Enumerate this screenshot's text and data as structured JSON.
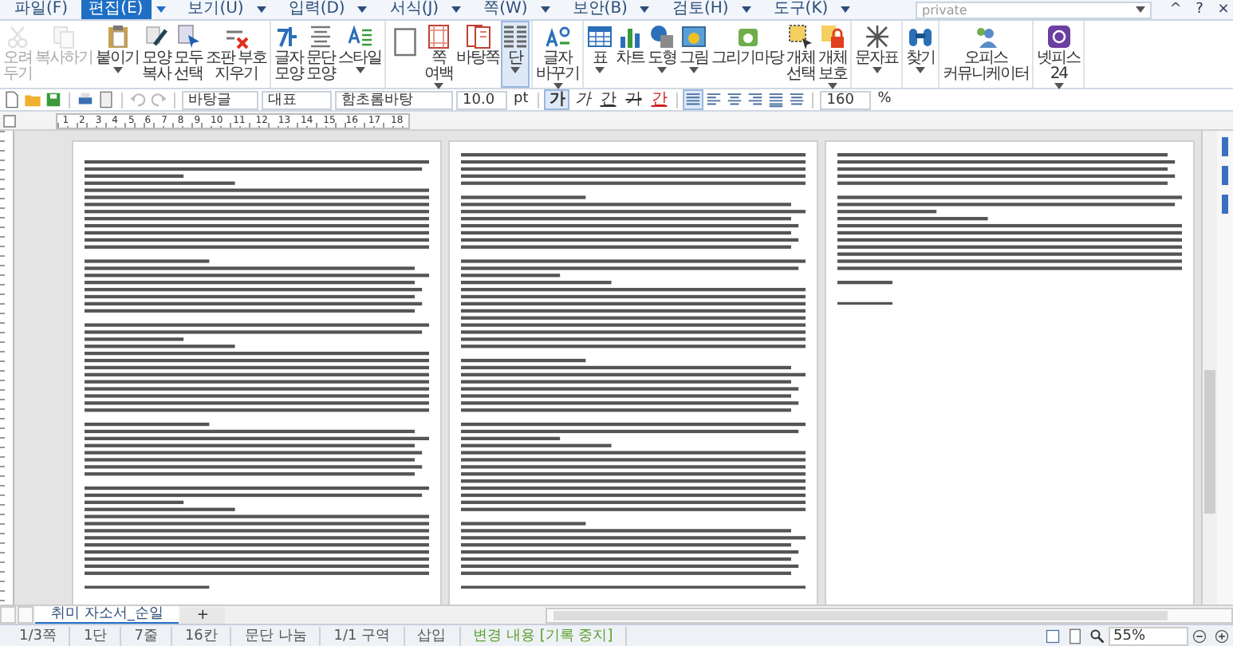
{
  "menu": [
    {
      "label": "파일(F)",
      "selected": false
    },
    {
      "label": "편집(E)",
      "selected": true
    },
    {
      "label": "보기(U)",
      "selected": false
    },
    {
      "label": "입력(D)",
      "selected": false
    },
    {
      "label": "서식(J)",
      "selected": false
    },
    {
      "label": "쪽(W)",
      "selected": false
    },
    {
      "label": "보안(B)",
      "selected": false
    },
    {
      "label": "검토(H)",
      "selected": false
    },
    {
      "label": "도구(K)",
      "selected": false
    }
  ],
  "search": {
    "value": "private"
  },
  "window_buttons": [
    "^",
    "?",
    "×"
  ],
  "ribbon": [
    {
      "buttons": [
        {
          "lines": [
            "오려",
            "두기"
          ],
          "disabled": true,
          "selected": false,
          "dropdown": false
        },
        {
          "lines": [
            "복사하기"
          ],
          "disabled": true,
          "selected": false,
          "dropdown": false
        },
        {
          "lines": [
            "붙이기"
          ],
          "disabled": false,
          "selected": false,
          "dropdown": true
        },
        {
          "lines": [
            "모양",
            "복사"
          ],
          "disabled": false,
          "selected": false,
          "dropdown": false
        },
        {
          "lines": [
            "모두",
            "선택"
          ],
          "disabled": false,
          "selected": false,
          "dropdown": false
        },
        {
          "lines": [
            "조판 부호",
            "지우기"
          ],
          "disabled": false,
          "selected": false,
          "dropdown": false
        }
      ]
    },
    {
      "buttons": [
        {
          "lines": [
            "글자",
            "모양"
          ],
          "disabled": false,
          "selected": false,
          "dropdown": false
        },
        {
          "lines": [
            "문단",
            "모양"
          ],
          "disabled": false,
          "selected": false,
          "dropdown": false
        },
        {
          "lines": [
            "스타일"
          ],
          "disabled": false,
          "selected": false,
          "dropdown": true
        }
      ]
    },
    {
      "buttons": [
        {
          "disabled": false,
          "selected": false,
          "dropdown": false
        },
        {
          "lines": [
            "쪽",
            "여백"
          ],
          "disabled": false,
          "selected": false,
          "dropdown": true
        },
        {
          "lines": [
            "바탕쪽"
          ],
          "disabled": false,
          "selected": false,
          "dropdown": false
        },
        {
          "lines": [
            "단"
          ],
          "disabled": false,
          "selected": true,
          "dropdown": true
        }
      ]
    },
    {
      "buttons": [
        {
          "lines": [
            "글자",
            "바꾸기"
          ],
          "disabled": false,
          "selected": false,
          "dropdown": true
        }
      ]
    },
    {
      "buttons": [
        {
          "lines": [
            "표"
          ],
          "disabled": false,
          "selected": false,
          "dropdown": true
        },
        {
          "lines": [
            "차트"
          ],
          "disabled": false,
          "selected": false,
          "dropdown": false
        },
        {
          "lines": [
            "도형"
          ],
          "disabled": false,
          "selected": false,
          "dropdown": true
        },
        {
          "lines": [
            "그림"
          ],
          "disabled": false,
          "selected": false,
          "dropdown": true
        },
        {
          "lines": [
            "그리기마당"
          ],
          "disabled": false,
          "selected": false,
          "dropdown": false
        },
        {
          "lines": [
            "개체",
            "선택"
          ],
          "disabled": false,
          "selected": false,
          "dropdown": false
        },
        {
          "lines": [
            "개체",
            "보호"
          ],
          "disabled": false,
          "selected": false,
          "dropdown": true
        }
      ]
    },
    {
      "buttons": [
        {
          "lines": [
            "문자표"
          ],
          "disabled": false,
          "selected": false,
          "dropdown": true
        }
      ]
    },
    {
      "buttons": [
        {
          "lines": [
            "찾기"
          ],
          "disabled": false,
          "selected": false,
          "dropdown": true
        }
      ]
    },
    {
      "buttons": [
        {
          "lines": [
            "오피스",
            "커뮤니케이터"
          ],
          "disabled": false,
          "selected": false,
          "dropdown": false
        }
      ]
    },
    {
      "buttons": [
        {
          "lines": [
            "넷피스",
            "24"
          ],
          "disabled": false,
          "selected": false,
          "dropdown": true
        }
      ]
    }
  ],
  "toolbar": {
    "style": "바탕글",
    "language": "대표",
    "font": "함초롬바탕",
    "size": "10.0",
    "size_unit": "pt",
    "format_buttons": [
      {
        "label": "가",
        "kind": "bold",
        "selected": true
      },
      {
        "label": "가",
        "kind": "italic",
        "selected": false
      },
      {
        "label": "간",
        "kind": "underline",
        "selected": false
      },
      {
        "label": "가",
        "kind": "strike",
        "selected": false
      },
      {
        "label": "간",
        "kind": "color",
        "selected": false
      }
    ],
    "align_buttons": [
      {
        "selected": true
      },
      {
        "selected": false
      },
      {
        "selected": false
      },
      {
        "selected": false
      },
      {
        "selected": false
      },
      {
        "selected": false
      }
    ],
    "line_spacing": "160",
    "line_spacing_unit": "%"
  },
  "ruler": {
    "labels": [
      "1",
      "2",
      "3",
      "4",
      "5",
      "6",
      "7",
      "8",
      "9",
      "10",
      "11",
      "12",
      "13",
      "14",
      "15",
      "16",
      "17",
      "18"
    ]
  },
  "tabs": [
    {
      "label": "취미 자소서_순일",
      "selected": true
    },
    {
      "label": "+",
      "selected": false
    }
  ],
  "status_bar": {
    "items": [
      {
        "text": "1/3쪽",
        "color": "#555555"
      },
      {
        "text": "1단",
        "color": "#555555"
      },
      {
        "text": "7줄",
        "color": "#555555"
      },
      {
        "text": "16칸",
        "color": "#555555"
      },
      {
        "text": "문단 나눔",
        "color": "#555555"
      },
      {
        "text": "1/1 구역",
        "color": "#555555"
      },
      {
        "text": "삽입",
        "color": "#555555"
      },
      {
        "text": "변경 내용 [기록 중지]",
        "color": "#5aa02c"
      }
    ],
    "zoom": "55%"
  }
}
